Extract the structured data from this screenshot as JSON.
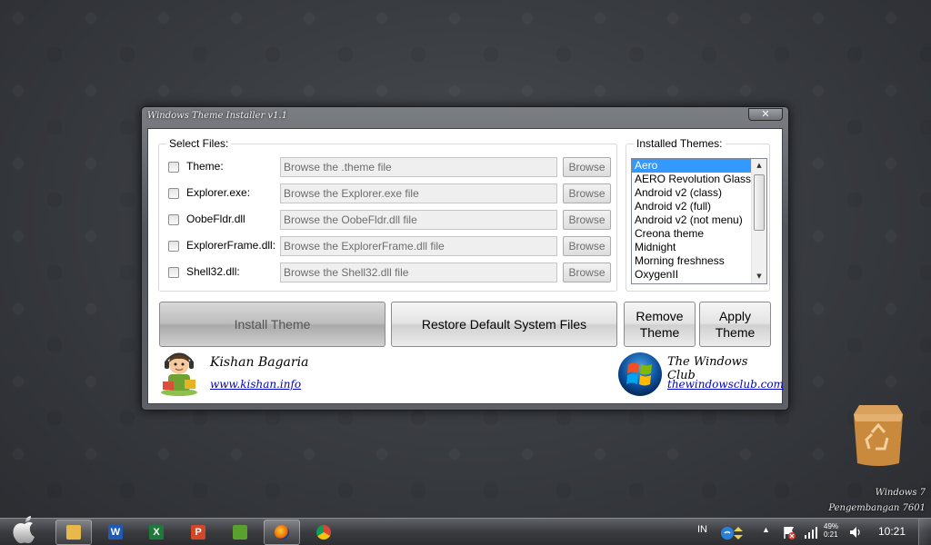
{
  "window": {
    "title": "Windows Theme Installer v1.1",
    "close_glyph": "✕"
  },
  "files_group": {
    "title": "Select Files:",
    "rows": [
      {
        "label": "Theme:",
        "placeholder": "Browse the .theme file",
        "button": "Browse",
        "checked": false
      },
      {
        "label": "Explorer.exe:",
        "placeholder": "Browse the Explorer.exe file",
        "button": "Browse",
        "checked": false
      },
      {
        "label": "OobeFldr.dll",
        "placeholder": "Browse the OobeFldr.dll file",
        "button": "Browse",
        "checked": false
      },
      {
        "label": "ExplorerFrame.dll:",
        "placeholder": "Browse the ExplorerFrame.dll file",
        "button": "Browse",
        "checked": false
      },
      {
        "label": "Shell32.dll:",
        "placeholder": "Browse the Shell32.dll file",
        "button": "Browse",
        "checked": false
      }
    ]
  },
  "themes_group": {
    "title": "Installed Themes:",
    "items": [
      "Aero",
      "AERO Revolution  Glass",
      "Android v2 (class)",
      "Android v2 (full)",
      "Android v2 (not menu)",
      "Creona theme",
      "Midnight",
      "Morning freshness",
      "OxygenII"
    ],
    "selected_index": 0
  },
  "actions": {
    "install": "Install Theme",
    "restore": "Restore Default System Files",
    "remove_line1": "Remove",
    "remove_line2": "Theme",
    "apply_line1": "Apply",
    "apply_line2": "Theme"
  },
  "credits": {
    "author_name": "Kishan Bagaria",
    "author_link": "www.kishan.info",
    "club_name": "The Windows Club",
    "club_link": "thewindowsclub.com"
  },
  "desktop": {
    "watermark_line1": "Windows 7",
    "watermark_line2": "Pengembangan 7601",
    "icons": [
      "recycle-bin-icon"
    ]
  },
  "taskbar": {
    "apps": [
      "explorer-icon",
      "word-icon",
      "excel-icon",
      "powerpoint-icon",
      "publisher-icon",
      "firefox-icon",
      "chrome-icon"
    ],
    "active_app": "firefox-icon",
    "language": "IN",
    "battery_percent": "49%",
    "battery_time": "0:21",
    "clock": "10:21"
  },
  "colors": {
    "selection": "#3399ff",
    "link": "#0000cc"
  }
}
